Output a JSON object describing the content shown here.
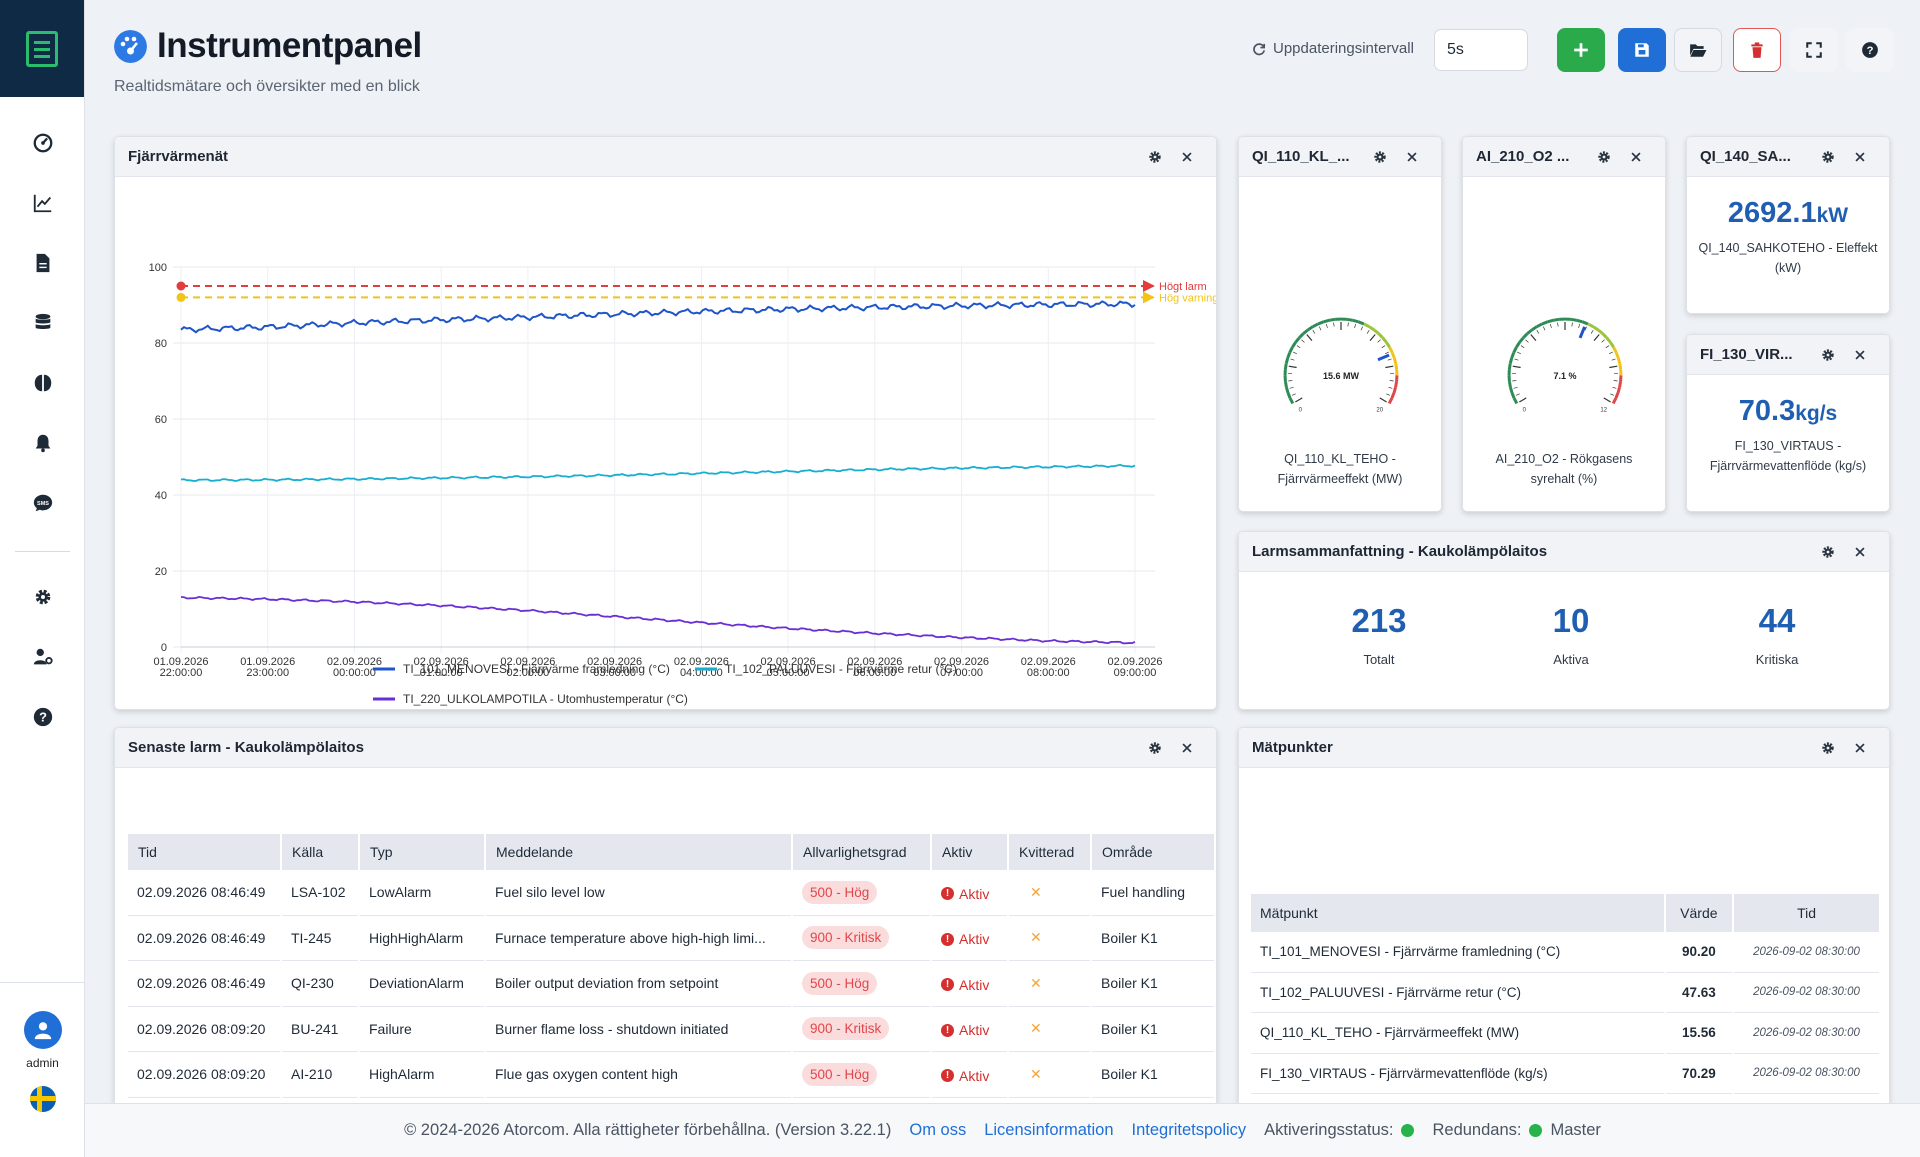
{
  "header": {
    "title": "Instrumentpanel",
    "subtitle": "Realtidsmätare och översikter med en blick",
    "update_label": "Uppdateringsintervall",
    "interval_value": "5s"
  },
  "sidebar": {
    "items": [
      {
        "icon": "gauge-icon"
      },
      {
        "icon": "line-chart-icon"
      },
      {
        "icon": "document-icon"
      },
      {
        "icon": "database-icon"
      },
      {
        "icon": "brain-icon"
      },
      {
        "icon": "bell-icon"
      },
      {
        "icon": "sms-icon"
      },
      {
        "icon": "gear-icon"
      },
      {
        "icon": "user-settings-icon"
      },
      {
        "icon": "help-icon"
      }
    ],
    "user": "admin"
  },
  "panels": {
    "chart": {
      "title": "Fjärrvärmenät"
    },
    "g1": {
      "title": "QI_110_KL_...",
      "label": "QI_110_KL_TEHO - Fjärrvärmeeffekt (MW)",
      "display": "15.6 MW",
      "min": "0",
      "max": "20"
    },
    "g2": {
      "title": "AI_210_O2 ...",
      "label": "AI_210_O2 - Rökgasens syrehalt (%)",
      "display": "7.1 %",
      "min": "0",
      "max": "12"
    },
    "k1": {
      "title": "QI_140_SA...",
      "value": "2692.1",
      "unit": "kW",
      "label": "QI_140_SAHKOTEHO - Eleffekt (kW)"
    },
    "k2": {
      "title": "FI_130_VIR...",
      "value": "70.3",
      "unit": "kg/s",
      "label": "FI_130_VIRTAUS - Fjärrvärmevattenflöde (kg/s)"
    },
    "alarmsum": {
      "title": "Larmsammanfattning - Kaukolämpölaitos",
      "total": "213",
      "total_label": "Totalt",
      "active": "10",
      "active_label": "Aktiva",
      "critical": "44",
      "critical_label": "Kritiska"
    },
    "alarms": {
      "title": "Senaste larm - Kaukolämpölaitos"
    },
    "points": {
      "title": "Mätpunkter"
    }
  },
  "gauges": {
    "g1_value": 15.6,
    "g1_max": 20,
    "g2_value": 7.1,
    "g2_max": 12
  },
  "alarm_table": {
    "headers": [
      "Tid",
      "Källa",
      "Typ",
      "Meddelande",
      "Allvarlighetsgrad",
      "Aktiv",
      "Kvitterad",
      "Område"
    ],
    "rows": [
      [
        "02.09.2026 08:46:49",
        "LSA-102",
        "LowAlarm",
        "Fuel silo level low",
        "500 - Hög",
        "Aktiv",
        "✕",
        "Fuel handling"
      ],
      [
        "02.09.2026 08:46:49",
        "TI-245",
        "HighHighAlarm",
        "Furnace temperature above high-high limi...",
        "900 - Kritisk",
        "Aktiv",
        "✕",
        "Boiler K1"
      ],
      [
        "02.09.2026 08:46:49",
        "QI-230",
        "DeviationAlarm",
        "Boiler output deviation from setpoint",
        "500 - Hög",
        "Aktiv",
        "✕",
        "Boiler K1"
      ],
      [
        "02.09.2026 08:09:20",
        "BU-241",
        "Failure",
        "Burner flame loss - shutdown initiated",
        "900 - Kritisk",
        "Aktiv",
        "✕",
        "Boiler K1"
      ],
      [
        "02.09.2026 08:09:20",
        "AI-210",
        "HighAlarm",
        "Flue gas oxygen content high",
        "500 - Hög",
        "Aktiv",
        "✕",
        "Boiler K1"
      ]
    ]
  },
  "points_table": {
    "headers": [
      "Mätpunkt",
      "Värde",
      "Tid"
    ],
    "rows": [
      [
        "TI_101_MENOVESI - Fjärrvärme framledning (°C)",
        "90.20",
        "2026-09-02 08:30:00"
      ],
      [
        "TI_102_PALUUVESI - Fjärrvärme retur (°C)",
        "47.63",
        "2026-09-02 08:30:00"
      ],
      [
        "QI_110_KL_TEHO - Fjärrvärmeeffekt (MW)",
        "15.56",
        "2026-09-02 08:30:00"
      ],
      [
        "FI_130_VIRTAUS - Fjärrvärmevattenflöde (kg/s)",
        "70.29",
        "2026-09-02 08:30:00"
      ]
    ]
  },
  "footer": {
    "copyright": "© 2024-2026 Atorcom. Alla rättigheter förbehållna. (Version 3.22.1)",
    "about": "Om oss",
    "license": "Licensinformation",
    "privacy": "Integritetspolicy",
    "activation": "Aktiveringsstatus:",
    "redundancy": "Redundans:",
    "master": "Master"
  },
  "colors": {
    "accent": "#1f6fd6",
    "green": "#25b34a",
    "danger": "#d4302f"
  },
  "chart_data": {
    "type": "line",
    "x": [
      "01.09.2026 22:00:00",
      "01.09.2026 23:00:00",
      "02.09.2026 00:00:00",
      "02.09.2026 01:00:00",
      "02.09.2026 02:00:00",
      "02.09.2026 03:00:00",
      "02.09.2026 04:00:00",
      "02.09.2026 05:00:00",
      "02.09.2026 06:00:00",
      "02.09.2026 07:00:00",
      "02.09.2026 08:00:00",
      "02.09.2026 09:00:00"
    ],
    "x_ticks": [
      [
        "01.09.2026",
        "22:00:00"
      ],
      [
        "01.09.2026",
        "23:00:00"
      ],
      [
        "02.09.2026",
        "00:00:00"
      ],
      [
        "02.09.2026",
        "01:00:00"
      ],
      [
        "02.09.2026",
        "02:00:00"
      ],
      [
        "02.09.2026",
        "03:00:00"
      ],
      [
        "02.09.2026",
        "04:00:00"
      ],
      [
        "02.09.2026",
        "05:00:00"
      ],
      [
        "02.09.2026",
        "06:00:00"
      ],
      [
        "02.09.2026",
        "07:00:00"
      ],
      [
        "02.09.2026",
        "08:00:00"
      ],
      [
        "02.09.2026",
        "09:00:00"
      ]
    ],
    "series": [
      {
        "name": "TI_101_MENOVESI - Fjärrvärme framledning (°C)",
        "color": "#1f55c8",
        "values": [
          83.5,
          84.2,
          85.3,
          86.1,
          86.8,
          87.6,
          88.3,
          88.9,
          89.4,
          89.8,
          90.1,
          90.3
        ]
      },
      {
        "name": "TI_102_PALUUVESI - Fjärrvärme retur (°C)",
        "color": "#17aecf",
        "values": [
          43.9,
          44.0,
          44.2,
          44.5,
          44.8,
          45.2,
          45.7,
          46.2,
          46.7,
          47.1,
          47.4,
          47.7
        ]
      },
      {
        "name": "TI_220_ULKOLAMPOTILA - Utomhustemperatur (°C)",
        "color": "#6a2fd4",
        "values": [
          13.0,
          12.6,
          11.9,
          10.9,
          9.6,
          8.0,
          6.4,
          4.9,
          3.6,
          2.5,
          1.6,
          1.1
        ]
      }
    ],
    "thresholds": [
      {
        "name": "Högt larm",
        "value": 95,
        "color": "#e23c3c"
      },
      {
        "name": "Hög varning",
        "value": 92,
        "color": "#f0c419"
      }
    ],
    "yticks": [
      "0",
      "20",
      "40",
      "60",
      "80",
      "100"
    ],
    "ylim": [
      0,
      100
    ],
    "grid": true,
    "legend": "bottom"
  }
}
